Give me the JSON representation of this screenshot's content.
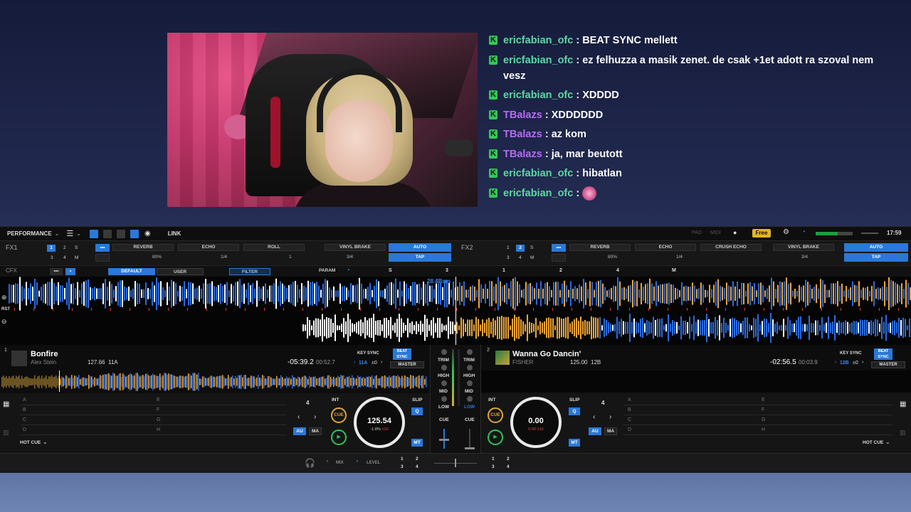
{
  "chat": {
    "messages": [
      {
        "user": "ericfabian_ofc",
        "color": "#5fd6a3",
        "text": " : BEAT SYNC mellett"
      },
      {
        "user": "ericfabian_ofc",
        "color": "#5fd6a3",
        "text": " : ez felhuzza a masik zenet. de csak +1et adott ra szoval nem vesz"
      },
      {
        "user": "ericfabian_ofc",
        "color": "#5fd6a3",
        "text": " : XDDDD"
      },
      {
        "user": "TBalazs",
        "color": "#b46cf0",
        "text": " : XDDDDDD"
      },
      {
        "user": "TBalazs",
        "color": "#b46cf0",
        "text": " : az kom"
      },
      {
        "user": "TBalazs",
        "color": "#b46cf0",
        "text": " : ja, mar beutott"
      },
      {
        "user": "ericfabian_ofc",
        "color": "#5fd6a3",
        "text": " : hibatlan"
      },
      {
        "user": "ericfabian_ofc",
        "color": "#5fd6a3",
        "text": " : ",
        "emote": "emote-icon"
      }
    ],
    "badge_glyph": "K"
  },
  "toolbar": {
    "mode": "PERFORMANCE",
    "link": "LINK",
    "pad_label": "PAD",
    "midi_label": "MIDI",
    "free_badge": "Free",
    "clock": "17:59"
  },
  "fx1": {
    "label": "FX1",
    "nums_top": [
      "1",
      "2",
      "S"
    ],
    "nums_bottom": [
      "3",
      "4",
      "M"
    ],
    "slots": [
      "REVERB",
      "ECHO",
      "ROLL",
      "VINYL BRAKE"
    ],
    "values": [
      "80%",
      "1/4",
      "1",
      "3/4"
    ],
    "auto": "AUTO",
    "tap": "TAP"
  },
  "fx2": {
    "label": "FX2",
    "nums_top": [
      "1",
      "2",
      "S"
    ],
    "nums_bottom": [
      "3",
      "4",
      "M"
    ],
    "slots": [
      "REVERB",
      "ECHO",
      "CRUSH ECHO",
      "VINYL BRAKE"
    ],
    "values": [
      "80%",
      "1/4",
      "3/4"
    ],
    "auto": "AUTO",
    "tap": "TAP"
  },
  "cfx": {
    "label": "CFX",
    "default": "DEFAULT",
    "user": "USER",
    "filter": "FILTER",
    "param": "PARAM",
    "s_label": "S",
    "numbers": [
      "3",
      "1",
      "2",
      "4",
      "M"
    ]
  },
  "waveform": {
    "beat_marker": "28.4Bars",
    "rst": "RST",
    "deck1_colors": [
      "#2a6be0",
      "#f0a637",
      "#ffffff"
    ]
  },
  "deck1": {
    "number": "1",
    "title": "Bonfire",
    "artist": "Alex Stein",
    "bpm": "127.66",
    "key": "11A",
    "time_remaining": "-05:39.2",
    "time_elapsed": "00:52.7",
    "key_sync": "KEY SYNC",
    "beat_sync": "BEAT SYNC",
    "key_display": "11A",
    "key_shift": "±0",
    "master": "MASTER",
    "pads_left": [
      "A",
      "B",
      "C",
      "D"
    ],
    "pads_right": [
      "E",
      "F",
      "G",
      "H"
    ],
    "hot_cue": "HOT CUE",
    "beat_count": "4",
    "int": "INT",
    "slip": "SLIP",
    "q": "Q",
    "au": "AU",
    "ma": "MA",
    "mt": "MT",
    "cue": "CUE",
    "jog_bpm": "125.54",
    "jog_pitch": "-1.8%",
    "jog_pitch_range": "±10"
  },
  "deck2": {
    "number": "2",
    "title": "Wanna Go Dancin'",
    "artist": "FISHER",
    "bpm": "125.00",
    "key": "12B",
    "time_remaining": "-02:56.5",
    "time_elapsed": "00:03.9",
    "key_sync": "KEY SYNC",
    "beat_sync": "BEAT SYNC",
    "key_display": "12B",
    "key_shift": "±0",
    "master": "MASTER",
    "pads_left": [
      "A",
      "B",
      "C",
      "D"
    ],
    "pads_right": [
      "E",
      "F",
      "G",
      "H"
    ],
    "hot_cue": "HOT CUE",
    "beat_count": "4",
    "int": "INT",
    "slip": "SLIP",
    "q": "Q",
    "au": "AU",
    "ma": "MA",
    "mt": "MT",
    "cue": "CUE",
    "jog_bpm": "0.00",
    "jog_pitch": "0.00",
    "jog_pitch_range": "±10"
  },
  "mixer": {
    "trim": "TRIM",
    "high": "HIGH",
    "mid": "MID",
    "low": "LOW",
    "cue": "CUE"
  },
  "bottom": {
    "mix": "MIX",
    "level": "LEVEL",
    "grid_left": [
      "1",
      "2",
      "3",
      "4"
    ],
    "grid_right": [
      "1",
      "2",
      "3",
      "4"
    ]
  }
}
